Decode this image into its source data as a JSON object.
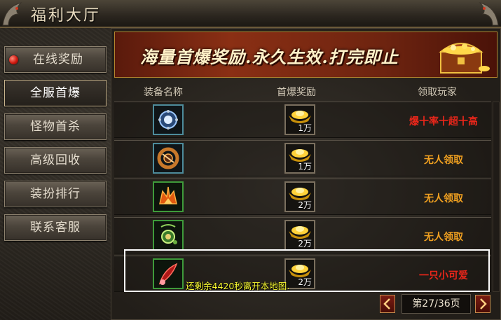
{
  "window": {
    "title": "福利大厅"
  },
  "sidebar": {
    "items": [
      {
        "label": "在线奖励",
        "active": false,
        "has_alert_dot": true
      },
      {
        "label": "全服首爆",
        "active": true,
        "has_alert_dot": false
      },
      {
        "label": "怪物首杀",
        "active": false,
        "has_alert_dot": false
      },
      {
        "label": "高级回收",
        "active": false,
        "has_alert_dot": false
      },
      {
        "label": "装扮排行",
        "active": false,
        "has_alert_dot": false
      },
      {
        "label": "联系客服",
        "active": false,
        "has_alert_dot": false
      }
    ]
  },
  "banner": {
    "text": "海量首爆奖励.永久生效.打完即止"
  },
  "table": {
    "headers": [
      "装备名称",
      "首爆奖励",
      "领取玩家"
    ],
    "rows": [
      {
        "item_icon": "blue-orb-necklace-icon",
        "reward_icon": "gold-ingot-icon",
        "reward_amount": "1万",
        "claimer": "爆十率十超十高",
        "claimer_color": "#e8261a"
      },
      {
        "item_icon": "bronze-ring-icon",
        "reward_icon": "gold-ingot-icon",
        "reward_amount": "1万",
        "claimer": "无人领取",
        "claimer_color": "#f0a020"
      },
      {
        "item_icon": "flame-helmet-icon",
        "reward_icon": "gold-ingot-icon",
        "reward_amount": "2万",
        "claimer": "无人领取",
        "claimer_color": "#f0a020"
      },
      {
        "item_icon": "jade-amulet-icon",
        "reward_icon": "gold-ingot-icon",
        "reward_amount": "2万",
        "claimer": "无人领取",
        "claimer_color": "#f0a020"
      },
      {
        "item_icon": "crimson-feather-icon",
        "reward_icon": "gold-ingot-icon",
        "reward_amount": "2万",
        "claimer": "一只小可爱",
        "claimer_color": "#e8261a"
      }
    ]
  },
  "pager": {
    "label": "第27/36页",
    "prev_icon": "chevron-left-icon",
    "next_icon": "chevron-right-icon"
  },
  "notice": {
    "text": "还剩余4420秒离开本地图."
  },
  "colors": {
    "accent_gold": "#b5862f",
    "claimer_red": "#e8261a",
    "claimer_orange": "#f0a020",
    "notice_yellow": "#ffff33"
  }
}
